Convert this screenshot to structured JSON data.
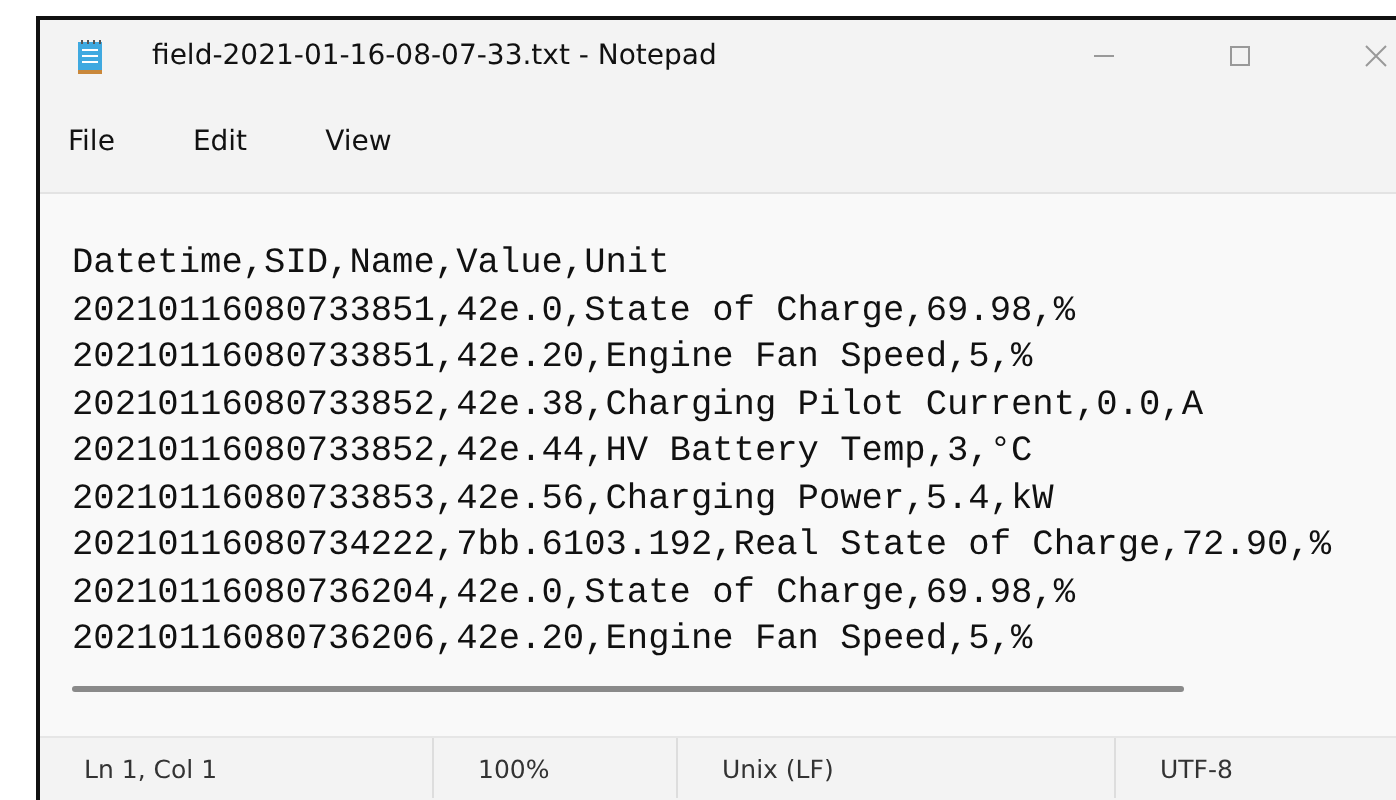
{
  "window": {
    "title": "field-2021-01-16-08-07-33.txt - Notepad"
  },
  "menu": [
    "File",
    "Edit",
    "View"
  ],
  "lines": [
    "Datetime,SID,Name,Value,Unit",
    "20210116080733851,42e.0,State of Charge,69.98,%",
    "20210116080733851,42e.20,Engine Fan Speed,5,%",
    "20210116080733852,42e.38,Charging Pilot Current,0.0,A",
    "20210116080733852,42e.44,HV Battery Temp,3,°C",
    "20210116080733853,42e.56,Charging Power,5.4,kW",
    "20210116080734222,7bb.6103.192,Real State of Charge,72.90,%",
    "20210116080736204,42e.0,State of Charge,69.98,%",
    "20210116080736206,42e.20,Engine Fan Speed,5,%"
  ],
  "status_bar": [
    "Ln 1, Col 1",
    "100%",
    "Unix (LF)",
    "UTF-8"
  ]
}
